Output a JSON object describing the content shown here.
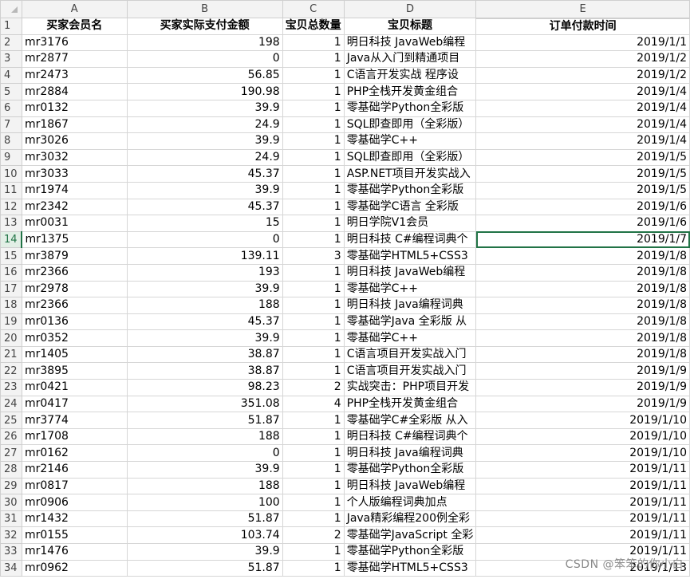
{
  "columns": [
    "A",
    "B",
    "C",
    "D",
    "E"
  ],
  "headers": [
    "买家会员名",
    "买家实际支付金额",
    "宝贝总数量",
    "宝贝标题",
    "订单付款时间"
  ],
  "rows": [
    {
      "n": "1"
    },
    {
      "n": "2",
      "a": "mr3176",
      "b": "198",
      "c": "1",
      "d": "明日科技 JavaWeb编程",
      "e": "2019/1/1"
    },
    {
      "n": "3",
      "a": "mr2877",
      "b": "0",
      "c": "1",
      "d": "Java从入门到精通项目",
      "e": "2019/1/2"
    },
    {
      "n": "4",
      "a": "mr2473",
      "b": "56.85",
      "c": "1",
      "d": "C语言开发实战 程序设",
      "e": "2019/1/2"
    },
    {
      "n": "5",
      "a": "mr2884",
      "b": "190.98",
      "c": "1",
      "d": "PHP全栈开发黄金组合",
      "e": "2019/1/4"
    },
    {
      "n": "6",
      "a": "mr0132",
      "b": "39.9",
      "c": "1",
      "d": "零基础学Python全彩版",
      "e": "2019/1/4"
    },
    {
      "n": "7",
      "a": "mr1867",
      "b": "24.9",
      "c": "1",
      "d": "SQL即查即用（全彩版）",
      "e": "2019/1/4"
    },
    {
      "n": "8",
      "a": "mr3026",
      "b": "39.9",
      "c": "1",
      "d": "零基础学C++",
      "e": "2019/1/4"
    },
    {
      "n": "9",
      "a": "mr3032",
      "b": "24.9",
      "c": "1",
      "d": "SQL即查即用（全彩版）",
      "e": "2019/1/5"
    },
    {
      "n": "10",
      "a": "mr3033",
      "b": "45.37",
      "c": "1",
      "d": "ASP.NET项目开发实战入",
      "e": "2019/1/5"
    },
    {
      "n": "11",
      "a": "mr1974",
      "b": "39.9",
      "c": "1",
      "d": "零基础学Python全彩版",
      "e": "2019/1/5"
    },
    {
      "n": "12",
      "a": "mr2342",
      "b": "45.37",
      "c": "1",
      "d": "零基础学C语言 全彩版",
      "e": "2019/1/6"
    },
    {
      "n": "13",
      "a": "mr0031",
      "b": "15",
      "c": "1",
      "d": "明日学院V1会员",
      "e": "2019/1/6"
    },
    {
      "n": "14",
      "a": "mr1375",
      "b": "0",
      "c": "1",
      "d": "明日科技 C#编程词典个",
      "e": "2019/1/7"
    },
    {
      "n": "15",
      "a": "mr3879",
      "b": "139.11",
      "c": "3",
      "d": "零基础学HTML5+CSS3",
      "e": "2019/1/8"
    },
    {
      "n": "16",
      "a": "mr2366",
      "b": "193",
      "c": "1",
      "d": "明日科技 JavaWeb编程",
      "e": "2019/1/8"
    },
    {
      "n": "17",
      "a": "mr2978",
      "b": "39.9",
      "c": "1",
      "d": "零基础学C++",
      "e": "2019/1/8"
    },
    {
      "n": "18",
      "a": "mr2366",
      "b": "188",
      "c": "1",
      "d": "明日科技 Java编程词典",
      "e": "2019/1/8"
    },
    {
      "n": "19",
      "a": "mr0136",
      "b": "45.37",
      "c": "1",
      "d": "零基础学Java 全彩版 从",
      "e": "2019/1/8"
    },
    {
      "n": "20",
      "a": "mr0352",
      "b": "39.9",
      "c": "1",
      "d": "零基础学C++",
      "e": "2019/1/8"
    },
    {
      "n": "21",
      "a": "mr1405",
      "b": "38.87",
      "c": "1",
      "d": "C语言项目开发实战入门",
      "e": "2019/1/8"
    },
    {
      "n": "22",
      "a": "mr3895",
      "b": "38.87",
      "c": "1",
      "d": "C语言项目开发实战入门",
      "e": "2019/1/9"
    },
    {
      "n": "23",
      "a": "mr0421",
      "b": "98.23",
      "c": "2",
      "d": "实战突击：PHP项目开发",
      "e": "2019/1/9"
    },
    {
      "n": "24",
      "a": "mr0417",
      "b": "351.08",
      "c": "4",
      "d": "PHP全栈开发黄金组合",
      "e": "2019/1/9"
    },
    {
      "n": "25",
      "a": "mr3774",
      "b": "51.87",
      "c": "1",
      "d": "零基础学C#全彩版 从入",
      "e": "2019/1/10"
    },
    {
      "n": "26",
      "a": "mr1708",
      "b": "188",
      "c": "1",
      "d": "明日科技 C#编程词典个",
      "e": "2019/1/10"
    },
    {
      "n": "27",
      "a": "mr0162",
      "b": "0",
      "c": "1",
      "d": "明日科技 Java编程词典",
      "e": "2019/1/10"
    },
    {
      "n": "28",
      "a": "mr2146",
      "b": "39.9",
      "c": "1",
      "d": "零基础学Python全彩版",
      "e": "2019/1/11"
    },
    {
      "n": "29",
      "a": "mr0817",
      "b": "188",
      "c": "1",
      "d": "明日科技 JavaWeb编程",
      "e": "2019/1/11"
    },
    {
      "n": "30",
      "a": "mr0906",
      "b": "100",
      "c": "1",
      "d": "个人版编程词典加点",
      "e": "2019/1/11"
    },
    {
      "n": "31",
      "a": "mr1432",
      "b": "51.87",
      "c": "1",
      "d": "Java精彩编程200例全彩",
      "e": "2019/1/11"
    },
    {
      "n": "32",
      "a": "mr0155",
      "b": "103.74",
      "c": "2",
      "d": "零基础学JavaScript 全彩",
      "e": "2019/1/11"
    },
    {
      "n": "33",
      "a": "mr1476",
      "b": "39.9",
      "c": "1",
      "d": "零基础学Python全彩版",
      "e": "2019/1/11"
    },
    {
      "n": "34",
      "a": "mr0962",
      "b": "51.87",
      "c": "1",
      "d": "零基础学HTML5+CSS3",
      "e": "2019/1/13"
    }
  ],
  "active_cell": {
    "row": "14",
    "column": "E"
  },
  "watermark": "CSDN @笨笨的你小白"
}
